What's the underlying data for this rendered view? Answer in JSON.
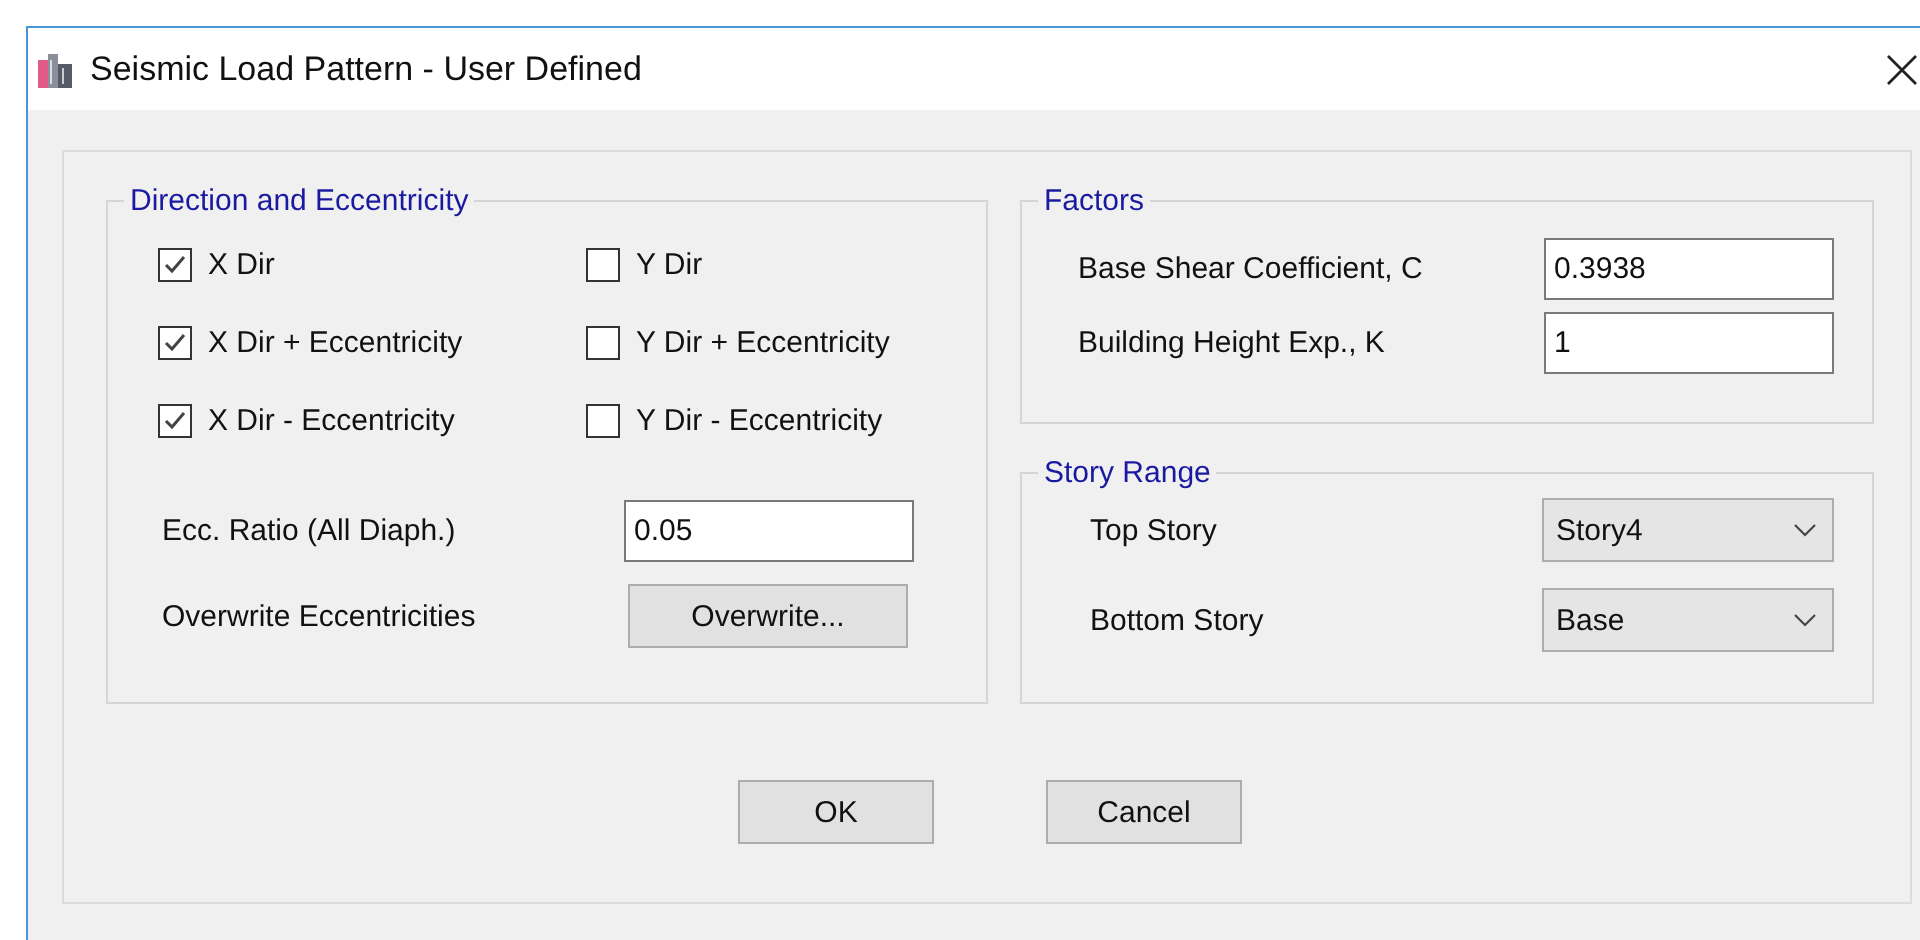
{
  "window": {
    "title": "Seismic Load Pattern - User Defined"
  },
  "direction_and_eccentricity": {
    "title": "Direction and Eccentricity",
    "checkboxes": [
      {
        "label": "X Dir",
        "checked": true
      },
      {
        "label": "Y Dir",
        "checked": false
      },
      {
        "label": "X Dir + Eccentricity",
        "checked": true
      },
      {
        "label": "Y Dir + Eccentricity",
        "checked": false
      },
      {
        "label": "X Dir - Eccentricity",
        "checked": true
      },
      {
        "label": "Y Dir - Eccentricity",
        "checked": false
      }
    ],
    "ecc_ratio": {
      "label": "Ecc. Ratio (All Diaph.)",
      "value": "0.05"
    },
    "overwrite": {
      "label": "Overwrite Eccentricities",
      "button": "Overwrite..."
    }
  },
  "factors": {
    "title": "Factors",
    "fields": [
      {
        "label": "Base Shear Coefficient, C",
        "value": "0.3938"
      },
      {
        "label": "Building Height Exp., K",
        "value": "1"
      }
    ]
  },
  "story_range": {
    "title": "Story Range",
    "dropdowns": [
      {
        "label": "Top Story",
        "value": "Story4"
      },
      {
        "label": "Bottom Story",
        "value": "Base"
      }
    ]
  },
  "buttons": [
    "OK",
    "Cancel"
  ]
}
